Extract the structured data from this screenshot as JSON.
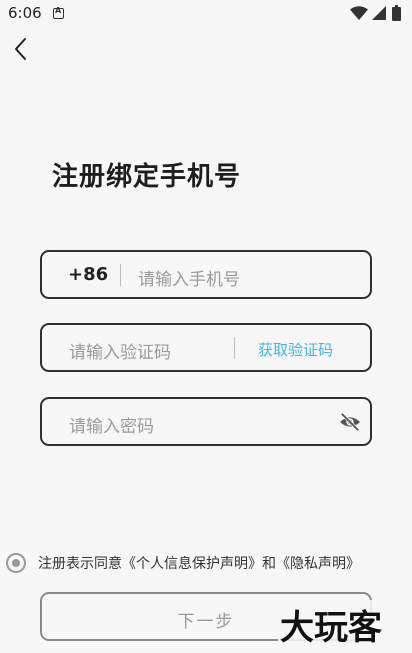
{
  "status_bar": {
    "time": "6:06",
    "icons": [
      "notification-a-icon",
      "wifi-icon",
      "signal-icon",
      "battery-icon"
    ]
  },
  "header": {
    "back_icon": "chevron-left-icon",
    "title": "注册绑定手机号"
  },
  "form": {
    "phone": {
      "country_code": "+86",
      "placeholder": "请输入手机号"
    },
    "code": {
      "placeholder": "请输入验证码",
      "get_code_label": "获取验证码"
    },
    "password": {
      "placeholder": "请输入密码",
      "toggle_icon": "eye-off-icon"
    }
  },
  "agreement": {
    "prefix": "注册表示同意",
    "privacy_protection": "《个人信息保护声明》",
    "and": "和",
    "privacy": "《隐私声明》"
  },
  "next_button": {
    "label": "下一步"
  },
  "watermark": "大玩客",
  "colors": {
    "background": "#f7f7f7",
    "accent": "#3fb7e8",
    "border": "#2f2f2f",
    "placeholder": "#9a9a9a"
  }
}
